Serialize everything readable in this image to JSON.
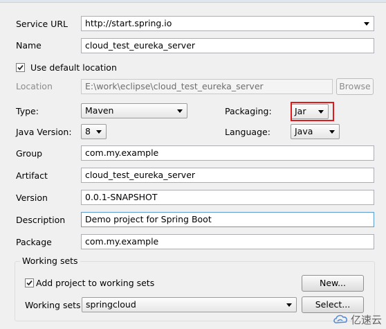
{
  "form": {
    "service_url": {
      "label": "Service URL",
      "value": "http://start.spring.io"
    },
    "name": {
      "label": "Name",
      "value": "cloud_test_eureka_server"
    },
    "use_default_location": {
      "label": "Use default location",
      "checked": true
    },
    "location": {
      "label": "Location",
      "value": "E:\\work\\eclipse\\cloud_test_eureka_server",
      "browse": "Browse"
    },
    "type": {
      "label": "Type:",
      "value": "Maven"
    },
    "packaging": {
      "label": "Packaging:",
      "value": "Jar"
    },
    "java_version": {
      "label": "Java Version:",
      "value": "8"
    },
    "language": {
      "label": "Language:",
      "value": "Java"
    },
    "group": {
      "label": "Group",
      "value": "com.my.example"
    },
    "artifact": {
      "label": "Artifact",
      "value": "cloud_test_eureka_server"
    },
    "version": {
      "label": "Version",
      "value": "0.0.1-SNAPSHOT"
    },
    "description": {
      "label": "Description",
      "value": "Demo project for Spring Boot"
    },
    "package": {
      "label": "Package",
      "value": "com.my.example"
    }
  },
  "working_sets": {
    "title": "Working sets",
    "add_label": "Add project to working sets",
    "add_checked": true,
    "new_button": "New...",
    "sets_label": "Working sets:",
    "sets_value": "springcloud",
    "select_button": "Select..."
  },
  "watermark": {
    "text": "亿速云"
  },
  "colors": {
    "highlight": "#e0191d",
    "field_border": "#abadb3",
    "background": "#f0f0f0"
  }
}
